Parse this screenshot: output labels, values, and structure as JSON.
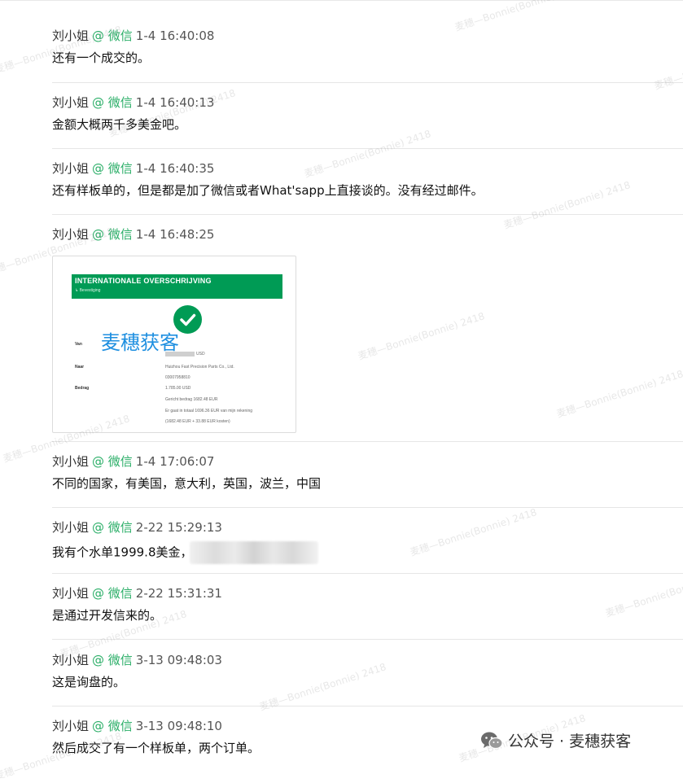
{
  "watermark": "麦穗—Bonnie(Bonnie) 2418",
  "messages": [
    {
      "name": "刘小姐",
      "source": "@ 微信",
      "time": "1-4 16:40:08",
      "text": "还有一个成交的。"
    },
    {
      "name": "刘小姐",
      "source": "@ 微信",
      "time": "1-4 16:40:13",
      "text": "金额大概两千多美金吧。"
    },
    {
      "name": "刘小姐",
      "source": "@ 微信",
      "time": "1-4 16:40:35",
      "text": "还有样板单的，但是都是加了微信或者What'sapp上直接谈的。没有经过邮件。"
    },
    {
      "name": "刘小姐",
      "source": "@ 微信",
      "time": "1-4 16:48:25"
    },
    {
      "name": "刘小姐",
      "source": "@ 微信",
      "time": "1-4 17:06:07",
      "text": "不同的国家，有美国，意大利，英国，波兰，中国"
    },
    {
      "name": "刘小姐",
      "source": "@ 微信",
      "time": "2-22 15:29:13",
      "text": "我有个水单1999.8美金，"
    },
    {
      "name": "刘小姐",
      "source": "@ 微信",
      "time": "2-22 15:31:31",
      "text": "是通过开发信来的。"
    },
    {
      "name": "刘小姐",
      "source": "@ 微信",
      "time": "3-13 09:48:03",
      "text": "这是询盘的。"
    },
    {
      "name": "刘小姐",
      "source": "@ 微信",
      "time": "3-13 09:48:10",
      "text": "然后成交了有一个样板单，两个订单。"
    }
  ],
  "attachment": {
    "banner_title": "INTERNATIONALE OVERSCHRIJVING",
    "banner_sub": "↳ Bevestiging",
    "overlay_text": "麦穗获客",
    "rows": [
      {
        "label": "Van",
        "value": "USD"
      },
      {
        "label": "Naar",
        "value": "Huizhou Fast Precision Parts Co., Ltd."
      },
      {
        "label": "",
        "value": "03007958810"
      },
      {
        "label": "Bedrag",
        "value": "1.785.00 USD"
      },
      {
        "label": "",
        "value": "Gericht bedrag 1682.48 EUR"
      },
      {
        "label": "",
        "value": "Er gaat in totaal 1696.36 EUR van mijn rekening"
      },
      {
        "label": "",
        "value": "(1682.48 EUR + 33.88 EUR kosten)"
      }
    ]
  },
  "footer": {
    "brand": "公众号 · 麦穗获客"
  },
  "colors": {
    "source_green": "#2aae67",
    "banner_green": "#009b55",
    "overlay_blue": "#1e8fe0"
  },
  "icons": {
    "check": "check-circle-icon",
    "footer": "wechat-logo-icon"
  }
}
